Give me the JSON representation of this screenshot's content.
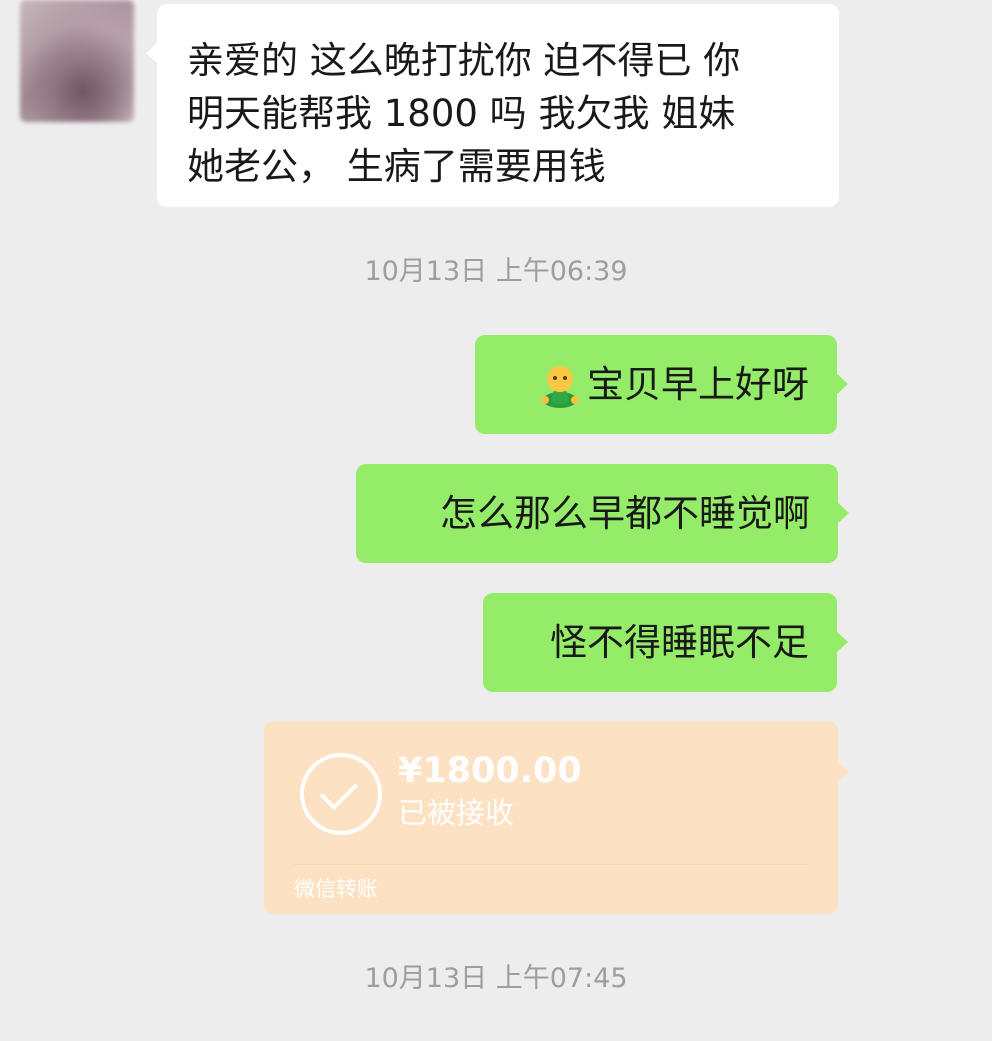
{
  "timestamps": [
    "10月13日 上午06:39",
    "10月13日 上午07:45"
  ],
  "messages": {
    "incoming_1": {
      "lines": [
        "亲爱的 这么晚打扰你 迫不得已 你",
        "明天能帮我 1800 吗 我欠我 姐妹",
        "她老公， 生病了需要用钱"
      ]
    },
    "outgoing_1": {
      "emoji": "person-emoji",
      "text": "宝贝早上好呀"
    },
    "outgoing_2": {
      "text": "怎么那么早都不睡觉啊"
    },
    "outgoing_3": {
      "text": "怪不得睡眠不足"
    }
  },
  "transfer": {
    "amount": "¥1800.00",
    "status": "已被接收",
    "label": "微信转账",
    "icon": "check-circle-icon"
  },
  "colors": {
    "background": "#ededed",
    "incoming_bubble": "#ffffff",
    "outgoing_bubble": "#95ec69",
    "transfer_card": "#fde1c3",
    "timestamp_text": "#9e9e9e"
  }
}
